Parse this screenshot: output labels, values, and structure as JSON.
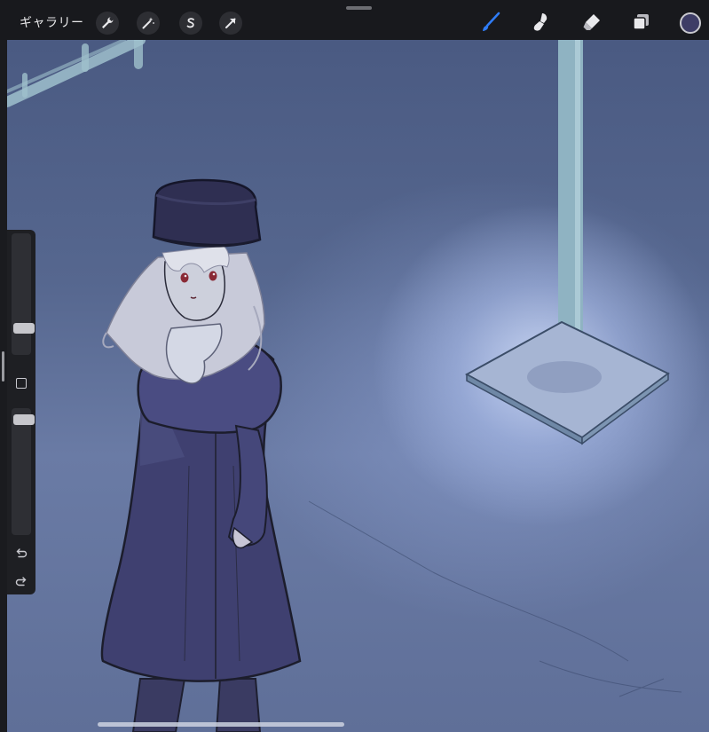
{
  "toolbar": {
    "gallery_label": "ギャラリー",
    "left_tools": [
      {
        "icon": "wrench-icon",
        "name": "actions"
      },
      {
        "icon": "magic-wand-icon",
        "name": "adjustments"
      },
      {
        "icon": "selection-s-icon",
        "name": "selection"
      },
      {
        "icon": "arrow-cursor-icon",
        "name": "transform"
      }
    ],
    "right_tools": [
      {
        "icon": "brush-icon",
        "name": "paint",
        "active": true
      },
      {
        "icon": "smudge-icon",
        "name": "smudge"
      },
      {
        "icon": "eraser-icon",
        "name": "eraser"
      },
      {
        "icon": "layers-icon",
        "name": "layers"
      }
    ],
    "current_color": "#3e3d66",
    "active_tool_color": "#2f7cf6"
  },
  "sidebar": {
    "brush_size_level": 0.82,
    "opacity_level": 0.0,
    "modify_icon": "square-icon",
    "undo_icon": "undo-icon",
    "redo_icon": "redo-icon"
  },
  "canvas": {
    "description_colors": {
      "background": "#56678f",
      "glow": "#d2def9",
      "coat": "#3e3f6c",
      "hair": "#c9cbd8",
      "pole": "#8fb3c2"
    }
  }
}
